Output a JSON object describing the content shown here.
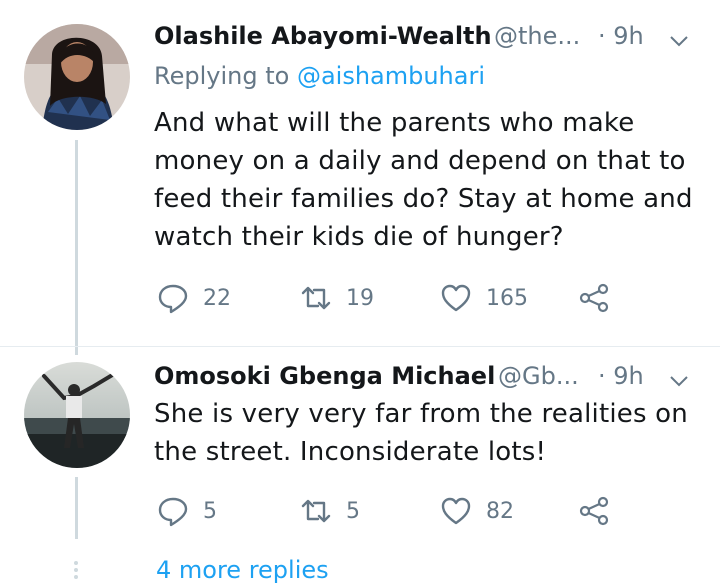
{
  "tweets": [
    {
      "name": "Olashile Abayomi-Wealth",
      "handle": "@the...",
      "time": "· 9h",
      "reply_prefix": "Replying to ",
      "reply_mention": "@aishambuhari",
      "lines": [
        "And what will the parents who make",
        "money on a daily and depend on that to",
        "feed their families do?  Stay at home and",
        "watch their kids die of hunger?"
      ],
      "replies": "22",
      "retweets": "19",
      "likes": "165"
    },
    {
      "name": "Omosoki Gbenga Michael",
      "handle": "@Gb...",
      "time": "· 9h",
      "lines": [
        "She is very very far from the realities on",
        "the street. Inconsiderate lots!"
      ],
      "replies": "5",
      "retweets": "5",
      "likes": "82"
    }
  ],
  "more_replies": "4 more replies",
  "colors": {
    "text": "#14171a",
    "muted": "#657786",
    "link": "#1da1f2",
    "line": "#cfd9de"
  },
  "icons": [
    "reply-icon",
    "retweet-icon",
    "like-icon",
    "share-icon",
    "chevron-down-icon"
  ]
}
